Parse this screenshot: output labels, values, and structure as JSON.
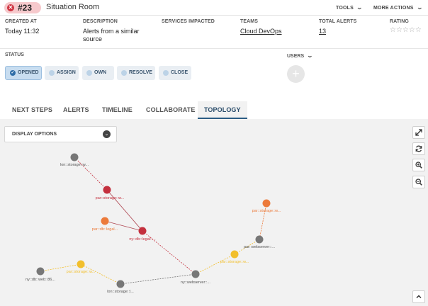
{
  "header": {
    "id_label": "#23",
    "title": "Situation Room",
    "tools_label": "TOOLS",
    "more_actions_label": "MORE ACTIONS"
  },
  "summary": {
    "created_at_label": "CREATED AT",
    "created_at_value": "Today 11:32",
    "description_label": "DESCRIPTION",
    "description_line1": "Alerts from a similar",
    "description_line2": "source",
    "services_label": "SERVICES IMPACTED",
    "teams_label": "TEAMS",
    "teams_value": "Cloud DevOps",
    "total_alerts_label": "TOTAL ALERTS",
    "total_alerts_value": "13",
    "rating_label": "RATING",
    "rating_stars": "☆☆☆☆☆",
    "rating_value": 0
  },
  "status": {
    "label": "STATUS",
    "users_label": "USERS",
    "add_user_symbol": "+",
    "buttons": {
      "opened": "OPENED",
      "assign": "ASSIGN",
      "own": "OWN",
      "resolve": "RESOLVE",
      "close": "CLOSE"
    }
  },
  "tabs": {
    "next_steps": "NEXT STEPS",
    "alerts": "ALERTS",
    "timeline": "TIMELINE",
    "collaborate": "COLLABORATE",
    "topology": "TOPOLOGY"
  },
  "topology": {
    "display_options_label": "DISPLAY OPTIONS",
    "toolbar_icons": [
      "expand-icon",
      "refresh-icon",
      "zoom-in-icon",
      "zoom-out-icon"
    ],
    "scroll_top_icon": "chevron-up-icon",
    "colors": {
      "critical": "#c4303e",
      "major": "#ec7a3a",
      "minor": "#f2bf2c",
      "normal": "#777777"
    },
    "nodes": [
      {
        "id": "lon-storage-w",
        "label": "lon::storage::w...",
        "status": "normal"
      },
      {
        "id": "par-storage-w",
        "label": "par::storage::w...",
        "status": "critical"
      },
      {
        "id": "par-db-legal",
        "label": "par::db::legal...",
        "status": "major"
      },
      {
        "id": "ny-db-legal",
        "label": "ny::db::legal::...",
        "status": "critical"
      },
      {
        "id": "par-storage-w2",
        "label": "par::storage::w...",
        "status": "major"
      },
      {
        "id": "par-webserver",
        "label": "par::webserver::...",
        "status": "normal"
      },
      {
        "id": "par-storage-w3",
        "label": "par::storage::w...",
        "status": "minor"
      },
      {
        "id": "ny-webserver",
        "label": "ny::webserver::...",
        "status": "normal"
      },
      {
        "id": "lon-storage-l",
        "label": "lon::storage::l...",
        "status": "normal"
      },
      {
        "id": "par-storage-w4",
        "label": "par::storage::w...",
        "status": "minor"
      },
      {
        "id": "ny-db-web",
        "label": "ny::db::web::86...",
        "status": "normal"
      }
    ],
    "edges": [
      {
        "from": "lon-storage-w",
        "to": "par-storage-w",
        "style": "dashed"
      },
      {
        "from": "par-storage-w",
        "to": "ny-db-legal",
        "style": "solid"
      },
      {
        "from": "par-db-legal",
        "to": "ny-db-legal",
        "style": "solid"
      },
      {
        "from": "ny-db-legal",
        "to": "ny-webserver",
        "style": "dashed"
      },
      {
        "from": "par-storage-w2",
        "to": "par-webserver",
        "style": "dashed"
      },
      {
        "from": "par-webserver",
        "to": "par-storage-w3",
        "style": "dashed"
      },
      {
        "from": "par-storage-w3",
        "to": "ny-webserver",
        "style": "dashed"
      },
      {
        "from": "ny-webserver",
        "to": "lon-storage-l",
        "style": "dashed"
      },
      {
        "from": "lon-storage-l",
        "to": "par-storage-w4",
        "style": "dashed"
      },
      {
        "from": "par-storage-w4",
        "to": "ny-db-web",
        "style": "dashed"
      }
    ]
  }
}
